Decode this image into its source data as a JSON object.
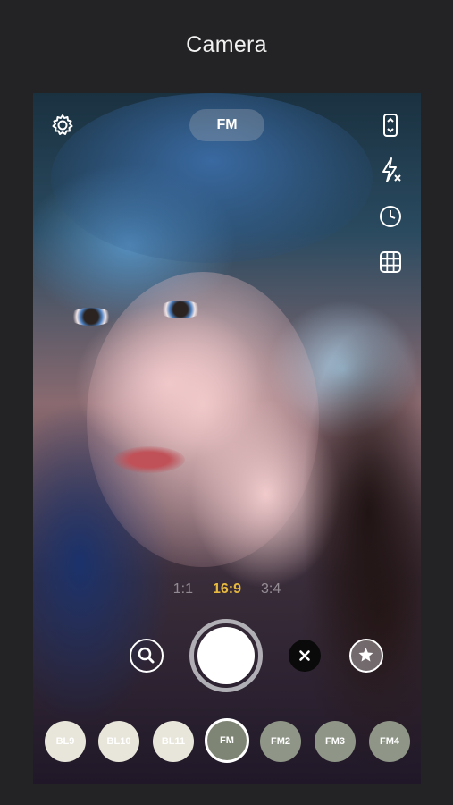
{
  "page": {
    "title": "Camera"
  },
  "top_bar": {
    "mode_label": "FM"
  },
  "icons": {
    "settings": "gear-icon",
    "flip": "camera-flip-icon",
    "flash": "flash-off-icon",
    "timer": "timer-icon",
    "grid": "grid-icon",
    "zoom": "magnifier-icon",
    "close": "close-icon",
    "favorite": "star-icon"
  },
  "aspect_ratios": {
    "options": [
      "1:1",
      "16:9",
      "3:4"
    ],
    "selected": "16:9"
  },
  "filters": {
    "items": [
      "BL9",
      "BL10",
      "BL11",
      "FM",
      "FM2",
      "FM3",
      "FM4"
    ],
    "selected": "FM"
  },
  "colors": {
    "accent": "#e7b93f",
    "background": "#232325"
  }
}
